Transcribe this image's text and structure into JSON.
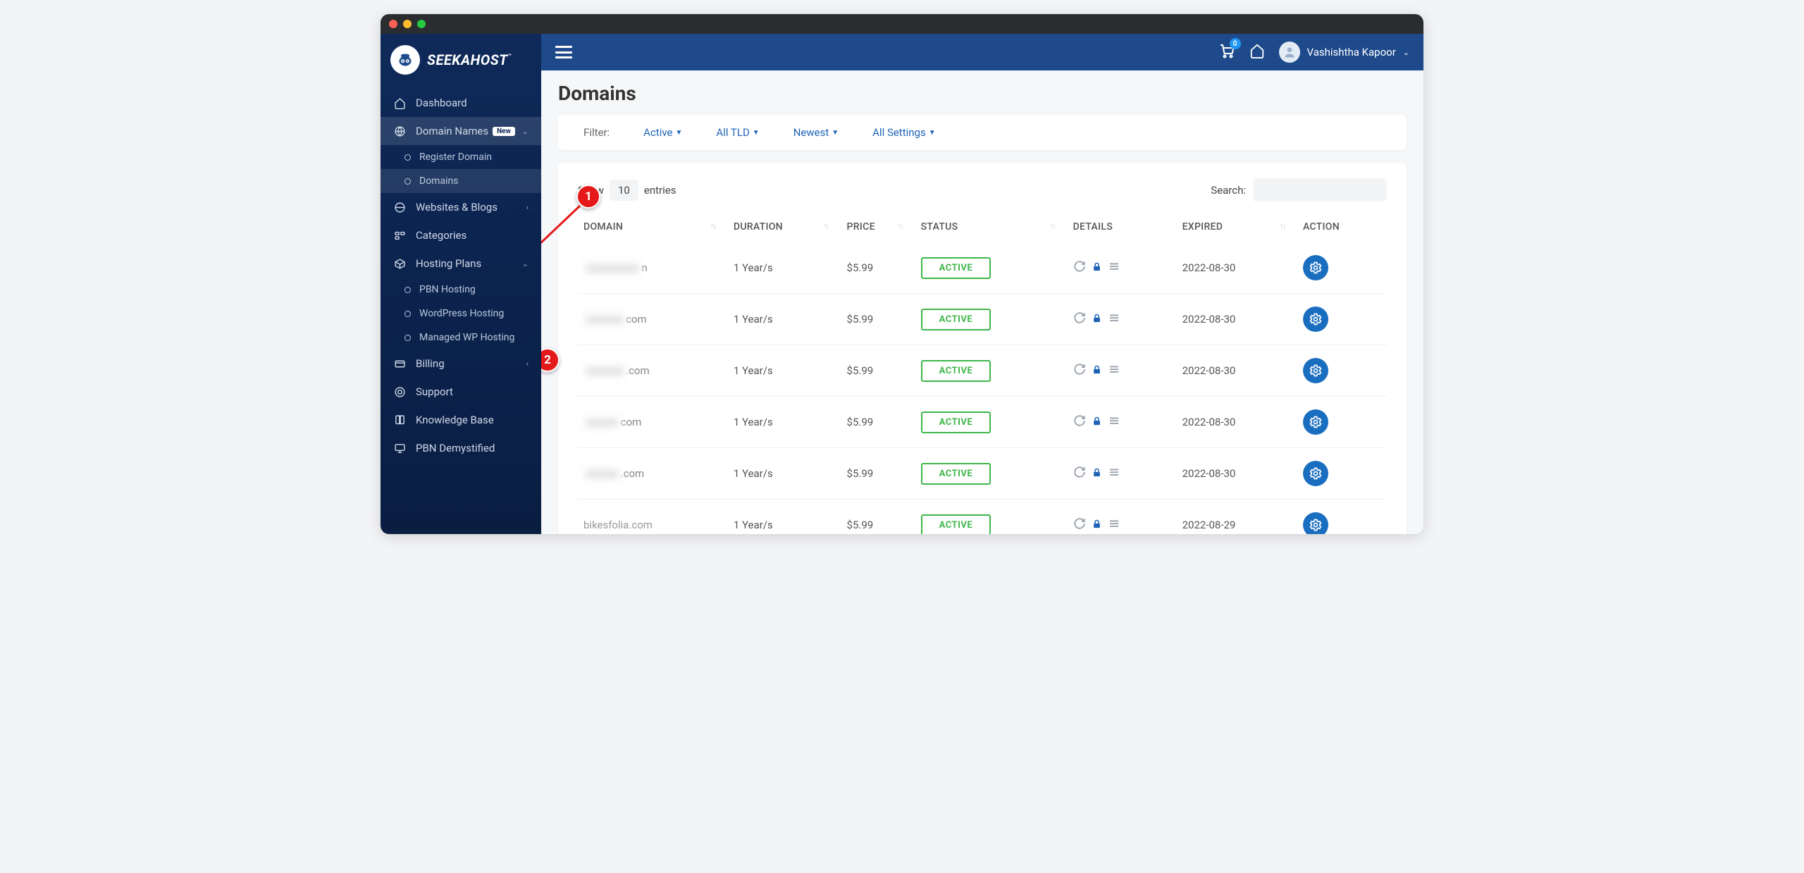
{
  "brand": "SEEKAHOST",
  "topbar": {
    "cart_count": "0",
    "user_name": "Vashishtha Kapoor"
  },
  "sidebar": {
    "dashboard": "Dashboard",
    "domain_names": {
      "label": "Domain Names",
      "badge": "New"
    },
    "domain_subs": {
      "register": "Register Domain",
      "domains": "Domains"
    },
    "websites": "Websites & Blogs",
    "categories": "Categories",
    "hosting_plans": "Hosting Plans",
    "hosting_subs": {
      "pbn": "PBN Hosting",
      "wp": "WordPress Hosting",
      "managed": "Managed WP Hosting"
    },
    "billing": "Billing",
    "support": "Support",
    "knowledge": "Knowledge Base",
    "pbn_demystified": "PBN Demystified"
  },
  "page": {
    "title": "Domains"
  },
  "filters": {
    "label": "Filter:",
    "active": "Active",
    "tld": "All TLD",
    "newest": "Newest",
    "settings": "All Settings"
  },
  "table_ctrl": {
    "show": "Show",
    "count": "10",
    "entries": "entries",
    "search_label": "Search:"
  },
  "columns": {
    "domain": "DOMAIN",
    "duration": "DURATION",
    "price": "PRICE",
    "status": "STATUS",
    "details": "DETAILS",
    "expired": "EXPIRED",
    "action": "ACTION"
  },
  "rows": [
    {
      "domain_blur": "xxxxxxxxxx",
      "domain_suffix": "n",
      "duration": "1 Year/s",
      "price": "$5.99",
      "status": "ACTIVE",
      "expired": "2022-08-30"
    },
    {
      "domain_blur": "xxxxxxx",
      "domain_suffix": "com",
      "duration": "1 Year/s",
      "price": "$5.99",
      "status": "ACTIVE",
      "expired": "2022-08-30"
    },
    {
      "domain_blur": "xxxxxxx",
      "domain_suffix": ".com",
      "duration": "1 Year/s",
      "price": "$5.99",
      "status": "ACTIVE",
      "expired": "2022-08-30"
    },
    {
      "domain_blur": "xxxxxx",
      "domain_suffix": "com",
      "duration": "1 Year/s",
      "price": "$5.99",
      "status": "ACTIVE",
      "expired": "2022-08-30"
    },
    {
      "domain_blur": "xxxxxx",
      "domain_suffix": ".com",
      "duration": "1 Year/s",
      "price": "$5.99",
      "status": "ACTIVE",
      "expired": "2022-08-30"
    },
    {
      "domain_plain": "bikesfolia.com",
      "duration": "1 Year/s",
      "price": "$5.99",
      "status": "ACTIVE",
      "expired": "2022-08-29"
    }
  ],
  "annotations": {
    "1": "1",
    "2": "2"
  }
}
